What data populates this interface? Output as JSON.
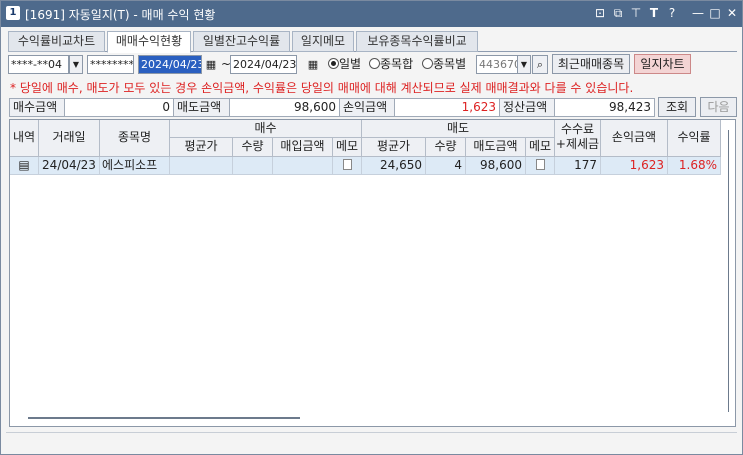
{
  "window": {
    "number": "1",
    "title": "[1691] 자동일지(T) - 매매 수익 현황"
  },
  "tabs": [
    "수익률비교차트",
    "매매수익현황",
    "일별잔고수익률",
    "일지메모",
    "보유종목수익률비교"
  ],
  "filters": {
    "account": "****-**04",
    "password": "********",
    "date_from": "2024/04/23",
    "tilde": "~",
    "date_to": "2024/04/23",
    "radio_daily": "일별",
    "radio_stock_sum": "종목합",
    "radio_by_stock": "종목별",
    "stock_code": "443670",
    "recent_btn": "최근매매종목",
    "chart_btn": "일지차트"
  },
  "notice": "* 당일에 매수, 매도가 모두 있는 경우 손익금액, 수익률은 당일의 매매에 대해 계산되므로 실제 매매결과와 다를 수 있습니다.",
  "summary": {
    "buy_label": "매수금액",
    "buy_value": "0",
    "sell_label": "매도금액",
    "sell_value": "98,600",
    "pl_label": "손익금액",
    "pl_value": "1,623",
    "settle_label": "정산금액",
    "settle_value": "98,423",
    "query_btn": "조회",
    "next_btn": "다음"
  },
  "headers": {
    "detail": "내역",
    "date": "거래일",
    "name": "종목명",
    "buy": "매수",
    "sell": "매도",
    "avg": "평균가",
    "qty": "수량",
    "buy_amount": "매입금액",
    "memo": "메모",
    "sell_amount": "매도금액",
    "fee_top": "수수료",
    "fee_bottom": "+제세금",
    "pl": "손익금액",
    "rate": "수익률"
  },
  "row": {
    "date": "24/04/23",
    "name": "에스피소프",
    "sell_avg": "24,650",
    "sell_qty": "4",
    "sell_amount": "98,600",
    "fee": "177",
    "pl": "1,623",
    "rate": "1.68%"
  }
}
